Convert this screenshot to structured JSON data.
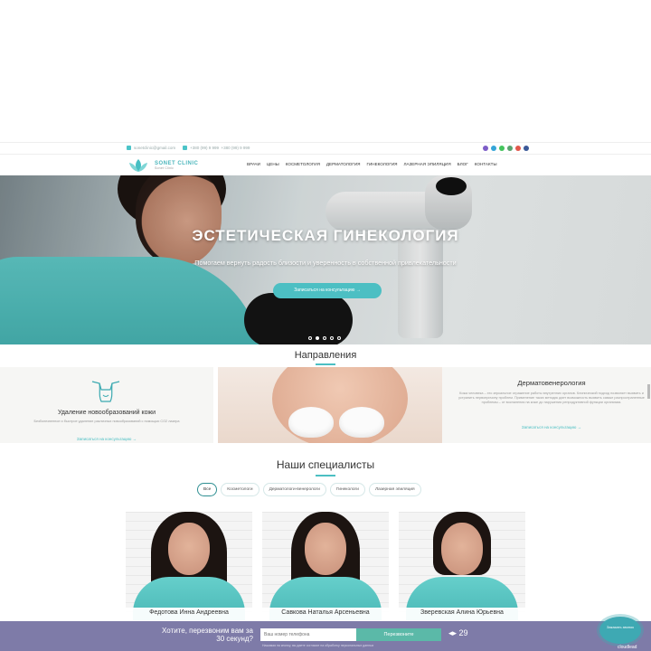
{
  "topbar": {
    "email": "sonetclinic@gmail.com",
    "phone1": "+380 (99) 9 999",
    "phone2": "+380 (99) 9 999",
    "socials": [
      {
        "icon": "viber-icon",
        "color": "#7d5dc7"
      },
      {
        "icon": "telegram-icon",
        "color": "#34a5d8"
      },
      {
        "icon": "whatsapp-icon",
        "color": "#43c45c"
      },
      {
        "icon": "phone-icon",
        "color": "#5aa36f"
      },
      {
        "icon": "instagram-icon",
        "color": "#e1574b"
      },
      {
        "icon": "facebook-icon",
        "color": "#3b5998"
      }
    ]
  },
  "header": {
    "logo": {
      "name": "SONET CLINIC",
      "tagline": "Sonet Clinic"
    },
    "nav": [
      "Врачи",
      "Цены",
      "Косметология",
      "Дерматология",
      "Гинекология",
      "Лазерная эпиляция",
      "Блог",
      "Контакты"
    ]
  },
  "hero": {
    "title": "ЭСТЕТИЧЕСКАЯ ГИНЕКОЛОГИЯ",
    "subtitle": "Помогаем вернуть радость близости и уверенность в собственной привлекательности",
    "cta": "Записаться на консультацию →",
    "slides_total": 5,
    "active_slide": 2
  },
  "directions": {
    "title": "Направления",
    "cards": [
      {
        "title": "Удаление новообразований кожи",
        "desc": "Безболезненное и быстрое удаление различных новообразований с помощью CO2 лазера",
        "more": "Записаться на консультацию →"
      },
      {
        "title": "Дерматовенерология",
        "desc": "Кожа человека – это зеркальное отражение работы внутренних органов. Клинический подход позволяет выявить и устранить первопричину проблем. Применение таких методик дает возможность выявить самые распространенные проблемы – от воспаления на коже до нарушения репродуктивной функции организма.",
        "more": "Записаться на консультацию →"
      }
    ]
  },
  "specialists": {
    "title": "Наши специалисты",
    "filters": [
      "Все",
      "Косметологи",
      "Дерматологи-венерологи",
      "Гинекологи",
      "Лазерная эпиляция"
    ],
    "active_filter": 0,
    "doctors": [
      {
        "name": "Федотова Инна Андреевна"
      },
      {
        "name": "Савкова Наталья Арсеньевна"
      },
      {
        "name": "Зверевская Алина Юрьевна"
      }
    ]
  },
  "promo": {
    "question": "Хотите, перезвоним вам за 30 секунд?",
    "placeholder": "Ваш номер телефона",
    "button": "Перезвоните",
    "timer": "29",
    "note": "Нажимая на кнопку, вы даете согласие на обработку персональных данных"
  },
  "callback": {
    "label": "Заказать звонок",
    "brand": "cloudlead"
  }
}
